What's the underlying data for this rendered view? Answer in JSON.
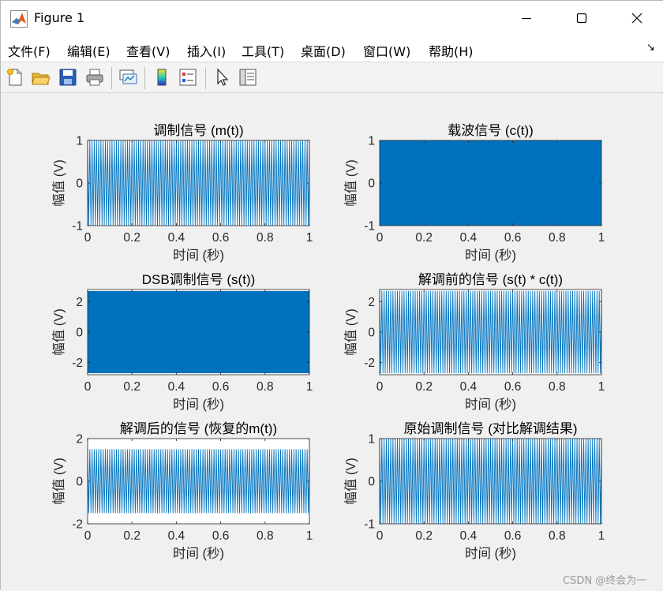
{
  "window": {
    "title": "Figure 1",
    "min_icon": "minimize-icon",
    "max_icon": "maximize-icon",
    "close_icon": "close-icon"
  },
  "menu": {
    "items": [
      "文件(F)",
      "编辑(E)",
      "查看(V)",
      "插入(I)",
      "工具(T)",
      "桌面(D)",
      "窗口(W)",
      "帮助(H)"
    ],
    "dock_arrow": "↘"
  },
  "toolbar": {
    "icons": [
      "new-figure-icon",
      "open-file-icon",
      "save-icon",
      "print-icon",
      "link-plot-icon",
      "colorbar-icon",
      "legend-icon",
      "pointer-icon",
      "property-editor-icon"
    ]
  },
  "colors": {
    "plot": "#0072bd",
    "axes": "#262626",
    "background": "#f0f0f0"
  },
  "watermark": "CSDN @终会为一",
  "chart_data": [
    {
      "type": "line",
      "title": "调制信号 (m(t))",
      "xlabel": "时间 (秒)",
      "ylabel": "幅值 (V)",
      "xlim": [
        0,
        1
      ],
      "ylim": [
        -1,
        1
      ],
      "xticks": [
        "0",
        "0.2",
        "0.4",
        "0.6",
        "0.8",
        "1"
      ],
      "yticks": [
        "-1",
        "0",
        "1"
      ],
      "series": [
        {
          "amplitude": 1,
          "cycles": 100,
          "fill": false
        }
      ]
    },
    {
      "type": "line",
      "title": "载波信号 (c(t))",
      "xlabel": "时间 (秒)",
      "ylabel": "幅值 (V)",
      "xlim": [
        0,
        1
      ],
      "ylim": [
        -1,
        1
      ],
      "xticks": [
        "0",
        "0.2",
        "0.4",
        "0.6",
        "0.8",
        "1"
      ],
      "yticks": [
        "-1",
        "0",
        "1"
      ],
      "series": [
        {
          "amplitude": 1,
          "cycles": 1000,
          "fill": true
        }
      ]
    },
    {
      "type": "line",
      "title": "DSB调制信号 (s(t))",
      "xlabel": "时间 (秒)",
      "ylabel": "幅值 (V)",
      "xlim": [
        0,
        1
      ],
      "ylim": [
        -2.8,
        2.8
      ],
      "xticks": [
        "0",
        "0.2",
        "0.4",
        "0.6",
        "0.8",
        "1"
      ],
      "yticks": [
        "-2",
        "0",
        "2"
      ],
      "series": [
        {
          "amplitude": 2.7,
          "cycles": 1000,
          "fill": true
        }
      ]
    },
    {
      "type": "line",
      "title": "解调前的信号 (s(t) * c(t))",
      "xlabel": "时间 (秒)",
      "ylabel": "幅值 (V)",
      "xlim": [
        0,
        1
      ],
      "ylim": [
        -2.8,
        2.8
      ],
      "xticks": [
        "0",
        "0.2",
        "0.4",
        "0.6",
        "0.8",
        "1"
      ],
      "yticks": [
        "-2",
        "0",
        "2"
      ],
      "series": [
        {
          "amplitude": 2.7,
          "cycles": 100,
          "fill": false
        }
      ]
    },
    {
      "type": "line",
      "title": "解调后的信号 (恢复的m(t))",
      "xlabel": "时间 (秒)",
      "ylabel": "幅值 (V)",
      "xlim": [
        0,
        1
      ],
      "ylim": [
        -2,
        2
      ],
      "xticks": [
        "0",
        "0.2",
        "0.4",
        "0.6",
        "0.8",
        "1"
      ],
      "yticks": [
        "-2",
        "0",
        "2"
      ],
      "series": [
        {
          "amplitude": 1.5,
          "cycles": 100,
          "fill": false
        }
      ]
    },
    {
      "type": "line",
      "title": "原始调制信号 (对比解调结果)",
      "xlabel": "时间 (秒)",
      "ylabel": "幅值 (V)",
      "xlim": [
        0,
        1
      ],
      "ylim": [
        -1,
        1
      ],
      "xticks": [
        "0",
        "0.2",
        "0.4",
        "0.6",
        "0.8",
        "1"
      ],
      "yticks": [
        "-1",
        "0",
        "1"
      ],
      "series": [
        {
          "amplitude": 1,
          "cycles": 100,
          "fill": false
        }
      ]
    }
  ]
}
